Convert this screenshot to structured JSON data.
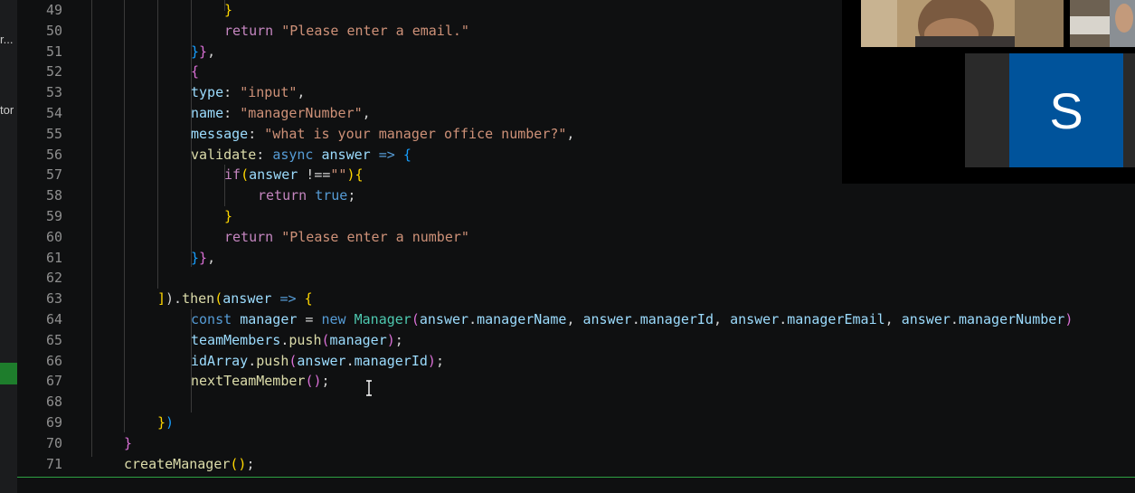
{
  "sidebar": {
    "truncated_item_1": "r...",
    "truncated_item_2": "tor"
  },
  "editor": {
    "line_numbers": [
      "49",
      "50",
      "51",
      "52",
      "53",
      "54",
      "55",
      "56",
      "57",
      "58",
      "59",
      "60",
      "61",
      "62",
      "63",
      "64",
      "65",
      "66",
      "67",
      "68",
      "69",
      "70",
      "71"
    ]
  },
  "video": {
    "participant_initial": "S",
    "avatar_color": "#00539b"
  },
  "colors": {
    "accent_status": "#2ea043",
    "string": "#ce9178",
    "keyword": "#c586c0",
    "property": "#9cdcfe"
  }
}
